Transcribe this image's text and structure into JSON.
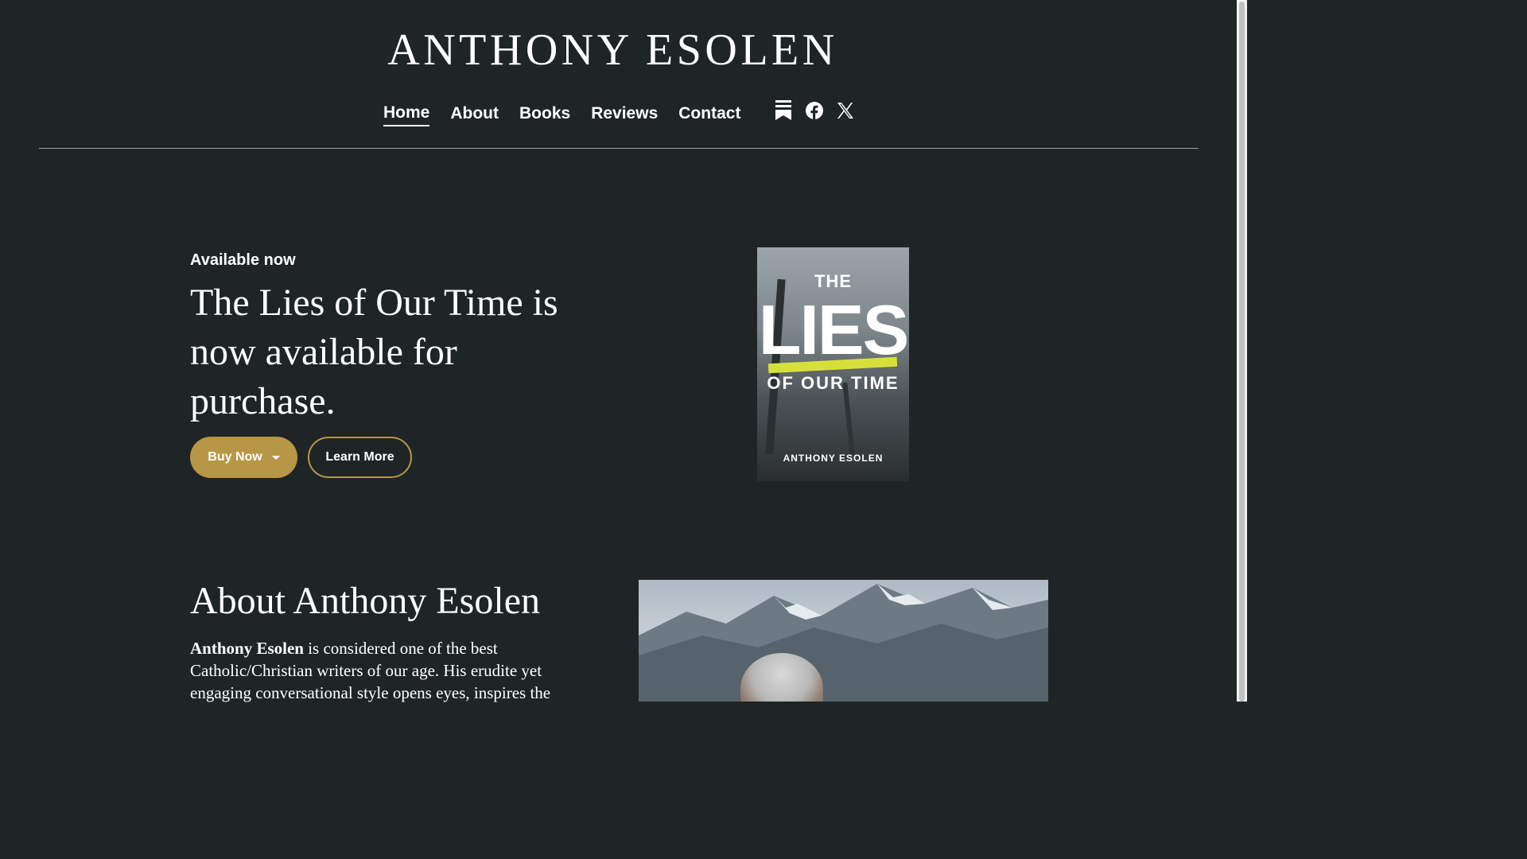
{
  "site": {
    "title": "ANTHONY ESOLEN"
  },
  "nav": {
    "items": [
      {
        "label": "Home",
        "active": true
      },
      {
        "label": "About",
        "active": false
      },
      {
        "label": "Books",
        "active": false
      },
      {
        "label": "Reviews",
        "active": false
      },
      {
        "label": "Contact",
        "active": false
      }
    ]
  },
  "social": {
    "icons": [
      "substack-icon",
      "facebook-icon",
      "x-twitter-icon"
    ]
  },
  "hero": {
    "eyebrow": "Available now",
    "headline": "The Lies of Our Time is now available for purchase.",
    "buy_label": "Buy Now",
    "learn_label": "Learn More"
  },
  "book_cover": {
    "line1": "THE",
    "line2": "LIES",
    "line3": "OF OUR TIME",
    "author": "ANTHONY ESOLEN"
  },
  "about": {
    "title": "About Anthony Esolen",
    "name_bold": "Anthony Esolen",
    "text": " is considered one of the best Catholic/Christian writers of our age. His erudite yet engaging conversational style opens eyes, inspires the"
  },
  "colors": {
    "background": "#1f2526",
    "accent": "#b79645",
    "highlight": "#d7e03a"
  }
}
